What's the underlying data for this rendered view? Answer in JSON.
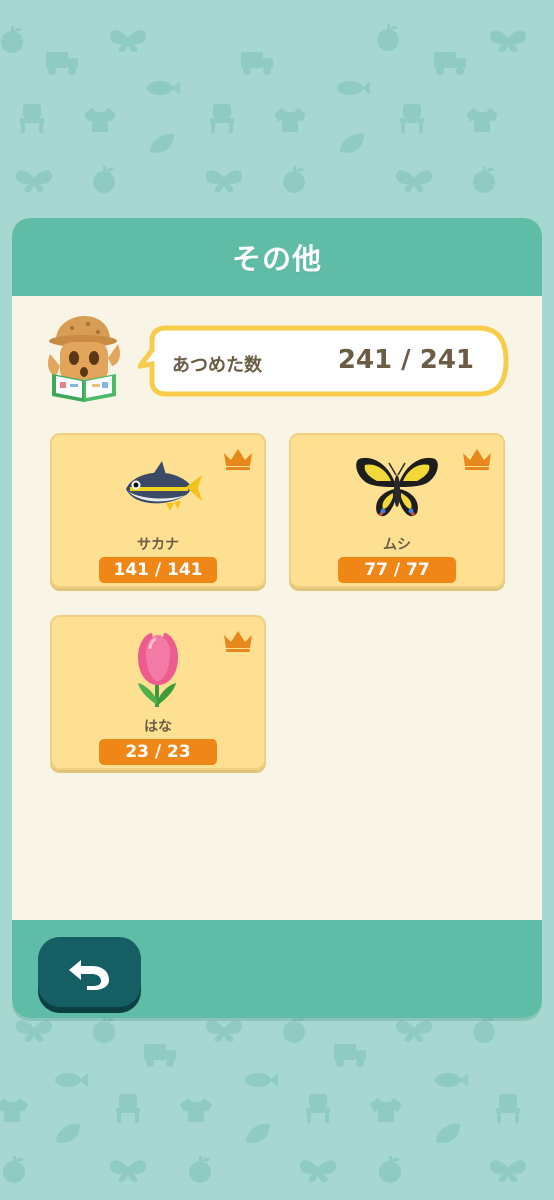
{
  "title": "その他",
  "summary": {
    "label": "あつめた数",
    "value": "241 / 241"
  },
  "categories": [
    {
      "name": "サカナ",
      "count": "141 / 141",
      "icon": "fish-icon",
      "complete_icon": "crown-icon"
    },
    {
      "name": "ムシ",
      "count": "77 / 77",
      "icon": "butterfly-icon",
      "complete_icon": "crown-icon"
    },
    {
      "name": "はな",
      "count": "23 / 23",
      "icon": "tulip-icon",
      "complete_icon": "crown-icon"
    }
  ],
  "footer": {
    "back_icon": "back-arrow-icon"
  },
  "colors": {
    "background": "#a6d8d1",
    "header": "#5fbca7",
    "panel": "#f9f5e6",
    "card": "#fde091",
    "pill": "#f08616",
    "back_button": "#155e63",
    "crown": "#e8881c"
  }
}
